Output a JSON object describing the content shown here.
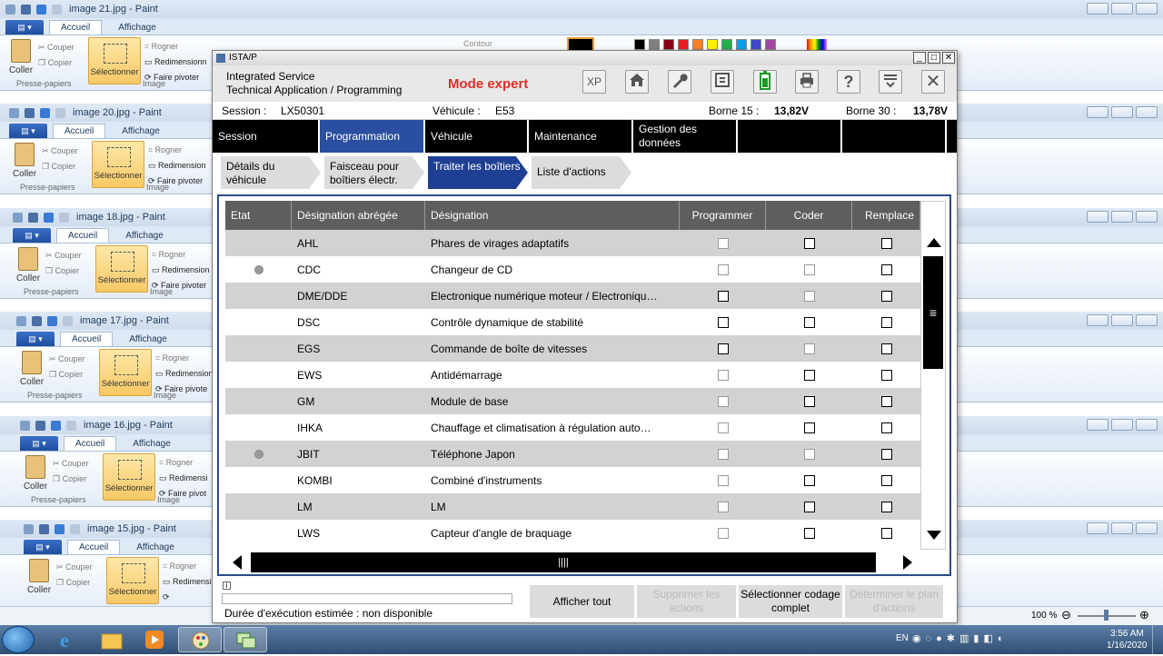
{
  "paint_windows": [
    {
      "title": "image 21.jpg - Paint",
      "tab_home": "Accueil",
      "tab_view": "Affichage",
      "paste": "Coller",
      "cut": "Couper",
      "copy": "Copier",
      "select": "Sélectionner",
      "crop": "Rogner",
      "resize": "Redimensionn",
      "rotate": "Faire pivoter",
      "group_clipboard": "Presse-papiers",
      "group_image": "Image",
      "outline": "Contour"
    },
    {
      "title": "image 20.jpg - Paint",
      "tab_home": "Accueil",
      "tab_view": "Affichage",
      "paste": "Coller",
      "cut": "Couper",
      "copy": "Copier",
      "select": "Sélectionner",
      "crop": "Rogner",
      "resize": "Redimension",
      "rotate": "Faire pivoter",
      "group_clipboard": "Presse-papiers",
      "group_image": "Image"
    },
    {
      "title": "image 18.jpg - Paint",
      "tab_home": "Accueil",
      "tab_view": "Affichage",
      "paste": "Coller",
      "cut": "Couper",
      "copy": "Copier",
      "select": "Sélectionner",
      "crop": "Rogner",
      "resize": "Redimension",
      "rotate": "Faire pivoter",
      "group_clipboard": "Presse-papiers",
      "group_image": "Image"
    },
    {
      "title": "image 17.jpg - Paint",
      "tab_home": "Accueil",
      "tab_view": "Affichage",
      "paste": "Coller",
      "cut": "Couper",
      "copy": "Copier",
      "select": "Sélectionner",
      "crop": "Rogner",
      "resize": "Redimension",
      "rotate": "Faire pivote",
      "group_clipboard": "Presse-papiers",
      "group_image": "Image"
    },
    {
      "title": "image 16.jpg - Paint",
      "tab_home": "Accueil",
      "tab_view": "Affichage",
      "paste": "Coller",
      "cut": "Couper",
      "copy": "Copier",
      "select": "Sélectionner",
      "crop": "Rogner",
      "resize": "Redimensi",
      "rotate": "Faire pivot",
      "group_clipboard": "Presse-papiers",
      "group_image": "Image"
    },
    {
      "title": "image 15.jpg - Paint",
      "tab_home": "Accueil",
      "tab_view": "Affichage",
      "paste": "Coller",
      "cut": "Couper",
      "copy": "Copier",
      "select": "Sélectionner",
      "crop": "Rogner",
      "resize": "Redimensi",
      "rotate": "",
      "group_clipboard": "",
      "group_image": ""
    }
  ],
  "ista": {
    "window_title": "ISTA/P",
    "app_line1": "Integrated Service",
    "app_line2": "Technical Application / Programming",
    "mode": "Mode expert",
    "toolbar_xp": "XP",
    "session_label": "Session :",
    "session_value": "LX50301",
    "vehicle_label": "Véhicule :",
    "vehicle_value": "E53",
    "borne15_label": "Borne 15 :",
    "borne15_value": "13,82V",
    "borne30_label": "Borne 30 :",
    "borne30_value": "13,78V",
    "nav": [
      "Session",
      "Programmation",
      "Véhicule",
      "Maintenance",
      "Gestion des données",
      "",
      ""
    ],
    "subtabs": [
      "Détails du véhicule",
      "Faisceau pour boîtiers électr.",
      "Traiter les boîtiers",
      "Liste d'actions"
    ],
    "columns": [
      "Etat",
      "Désignation abrégée",
      "Désignation",
      "Programmer",
      "Coder",
      "Remplace"
    ],
    "rows": [
      {
        "etat": false,
        "short": "AHL",
        "name": "Phares de virages adaptatifs",
        "prog": "grey",
        "coder": "black",
        "repl": "black"
      },
      {
        "etat": true,
        "short": "CDC",
        "name": "Changeur de CD",
        "prog": "grey",
        "coder": "grey",
        "repl": "black"
      },
      {
        "etat": false,
        "short": "DME/DDE",
        "name": "Electronique numérique moteur / Electroniqu…",
        "prog": "black",
        "coder": "grey",
        "repl": "black"
      },
      {
        "etat": false,
        "short": "DSC",
        "name": "Contrôle dynamique de stabilité",
        "prog": "black",
        "coder": "black",
        "repl": "black"
      },
      {
        "etat": false,
        "short": "EGS",
        "name": "Commande de boîte de vitesses",
        "prog": "black",
        "coder": "grey",
        "repl": "black"
      },
      {
        "etat": false,
        "short": "EWS",
        "name": "Antidémarrage",
        "prog": "grey",
        "coder": "black",
        "repl": "black"
      },
      {
        "etat": false,
        "short": "GM",
        "name": "Module de base",
        "prog": "grey",
        "coder": "black",
        "repl": "black"
      },
      {
        "etat": false,
        "short": "IHKA",
        "name": "Chauffage et climatisation à régulation auto…",
        "prog": "grey",
        "coder": "black",
        "repl": "black"
      },
      {
        "etat": true,
        "short": "JBIT",
        "name": "Téléphone Japon",
        "prog": "grey",
        "coder": "grey",
        "repl": "black"
      },
      {
        "etat": false,
        "short": "KOMBI",
        "name": "Combiné d'instruments",
        "prog": "grey",
        "coder": "black",
        "repl": "black"
      },
      {
        "etat": false,
        "short": "LM",
        "name": "LM",
        "prog": "grey",
        "coder": "black",
        "repl": "black"
      },
      {
        "etat": false,
        "short": "LWS",
        "name": "Capteur d'angle de braquage",
        "prog": "grey",
        "coder": "black",
        "repl": "black"
      }
    ],
    "duration_label": "Durée d'exécution estimée : non disponible",
    "btn_show_all": "Afficher tout",
    "btn_delete": "Supprimer les actions",
    "btn_select_coding": "Sélectionner codage complet",
    "btn_plan": "Déterminer le plan d'actions"
  },
  "statusbar": {
    "zoom": "100 %"
  },
  "taskbar": {
    "lang": "EN",
    "time": "3:56 AM",
    "date": "1/16/2020"
  }
}
